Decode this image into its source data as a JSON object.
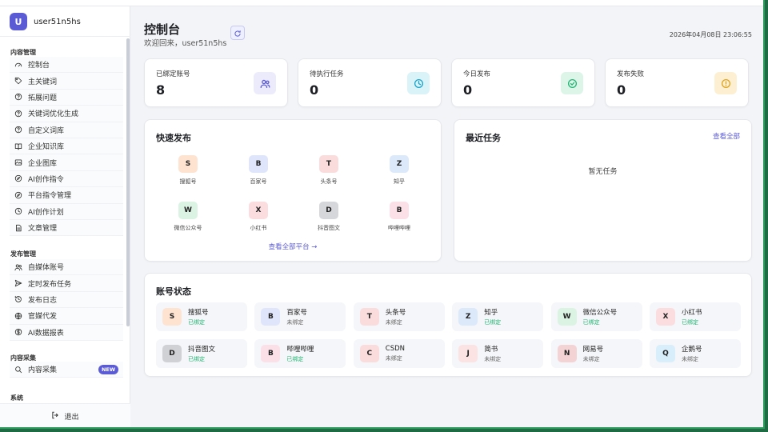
{
  "colors": {
    "accent": "#5b5bd6",
    "bound": "#22b573",
    "unbound": "#666666"
  },
  "sidebar": {
    "user": {
      "initial": "U",
      "name": "user51n5hs"
    },
    "sections": [
      {
        "title": "内容管理",
        "items": [
          {
            "label": "控制台",
            "icon": "dashboard-icon"
          },
          {
            "label": "主关键词",
            "icon": "tag-icon"
          },
          {
            "label": "拓展问题",
            "icon": "help-circle-icon"
          },
          {
            "label": "关键词优化生成",
            "icon": "help-circle-icon"
          },
          {
            "label": "自定义词库",
            "icon": "help-circle-icon"
          },
          {
            "label": "企业知识库",
            "icon": "book-icon"
          },
          {
            "label": "企业图库",
            "icon": "image-icon"
          },
          {
            "label": "AI创作指令",
            "icon": "compass-icon"
          },
          {
            "label": "平台指令管理",
            "icon": "compass-icon"
          },
          {
            "label": "AI创作计划",
            "icon": "clock-icon"
          },
          {
            "label": "文章管理",
            "icon": "document-icon"
          }
        ]
      },
      {
        "title": "发布管理",
        "items": [
          {
            "label": "自媒体账号",
            "icon": "users-icon"
          },
          {
            "label": "定时发布任务",
            "icon": "send-icon"
          },
          {
            "label": "发布日志",
            "icon": "history-icon"
          },
          {
            "label": "官媒代发",
            "icon": "globe-icon"
          },
          {
            "label": "AI数据报表",
            "icon": "dollar-icon"
          }
        ]
      },
      {
        "title": "内容采集",
        "items": [
          {
            "label": "内容采集",
            "icon": "search-icon",
            "badge": "NEW"
          }
        ]
      },
      {
        "title": "系统",
        "items": []
      }
    ],
    "logout_label": "退出"
  },
  "header": {
    "title": "控制台",
    "welcome": "欢迎回来，user51n5hs",
    "datetime": "2026年04月08日 23:06:55"
  },
  "stats": [
    {
      "label": "已绑定账号",
      "value": "8",
      "icon": "users-icon",
      "bg": "#ecebfb",
      "fg": "#5b5bd6"
    },
    {
      "label": "待执行任务",
      "value": "0",
      "icon": "clock-icon",
      "bg": "#d9f3f9",
      "fg": "#1aa3c9"
    },
    {
      "label": "今日发布",
      "value": "0",
      "icon": "check-circle-icon",
      "bg": "#dcf5e8",
      "fg": "#22b573"
    },
    {
      "label": "发布失败",
      "value": "0",
      "icon": "alert-circle-icon",
      "bg": "#fdefd2",
      "fg": "#e0a21a"
    }
  ],
  "quick_publish": {
    "title": "快速发布",
    "platforms": [
      {
        "letter": "S",
        "name": "搜狐号",
        "bg": "#fde3d0"
      },
      {
        "letter": "B",
        "name": "百家号",
        "bg": "#dfe6fb"
      },
      {
        "letter": "T",
        "name": "头条号",
        "bg": "#fbdcdc"
      },
      {
        "letter": "Z",
        "name": "知乎",
        "bg": "#dbe9fb"
      },
      {
        "letter": "W",
        "name": "微信公众号",
        "bg": "#dbf3e2"
      },
      {
        "letter": "X",
        "name": "小红书",
        "bg": "#fbdde0"
      },
      {
        "letter": "D",
        "name": "抖音图文",
        "bg": "#d6d7da"
      },
      {
        "letter": "B",
        "name": "哔哩哔哩",
        "bg": "#fbe0e8"
      }
    ],
    "view_all": "查看全部平台 →"
  },
  "recent_tasks": {
    "title": "最近任务",
    "link": "查看全部",
    "empty": "暂无任务"
  },
  "account_status": {
    "title": "账号状态",
    "accounts": [
      {
        "letter": "S",
        "name": "搜狐号",
        "status": "已绑定",
        "bound": true,
        "bg": "#fde3d0"
      },
      {
        "letter": "B",
        "name": "百家号",
        "status": "未绑定",
        "bound": false,
        "bg": "#dfe6fb"
      },
      {
        "letter": "T",
        "name": "头条号",
        "status": "未绑定",
        "bound": false,
        "bg": "#fbdcdc"
      },
      {
        "letter": "Z",
        "name": "知乎",
        "status": "已绑定",
        "bound": true,
        "bg": "#dbe9fb"
      },
      {
        "letter": "W",
        "name": "微信公众号",
        "status": "已绑定",
        "bound": true,
        "bg": "#dbf3e2"
      },
      {
        "letter": "X",
        "name": "小红书",
        "status": "已绑定",
        "bound": true,
        "bg": "#fbdde0"
      },
      {
        "letter": "D",
        "name": "抖音图文",
        "status": "已绑定",
        "bound": true,
        "bg": "#d0d1d4"
      },
      {
        "letter": "B",
        "name": "哔哩哔哩",
        "status": "已绑定",
        "bound": true,
        "bg": "#fbe0e8"
      },
      {
        "letter": "C",
        "name": "CSDN",
        "status": "未绑定",
        "bound": false,
        "bg": "#fbdcdc"
      },
      {
        "letter": "J",
        "name": "简书",
        "status": "未绑定",
        "bound": false,
        "bg": "#fbe3e3"
      },
      {
        "letter": "N",
        "name": "网易号",
        "status": "未绑定",
        "bound": false,
        "bg": "#f3d3d3"
      },
      {
        "letter": "Q",
        "name": "企鹅号",
        "status": "未绑定",
        "bound": false,
        "bg": "#d9eefb"
      }
    ]
  }
}
